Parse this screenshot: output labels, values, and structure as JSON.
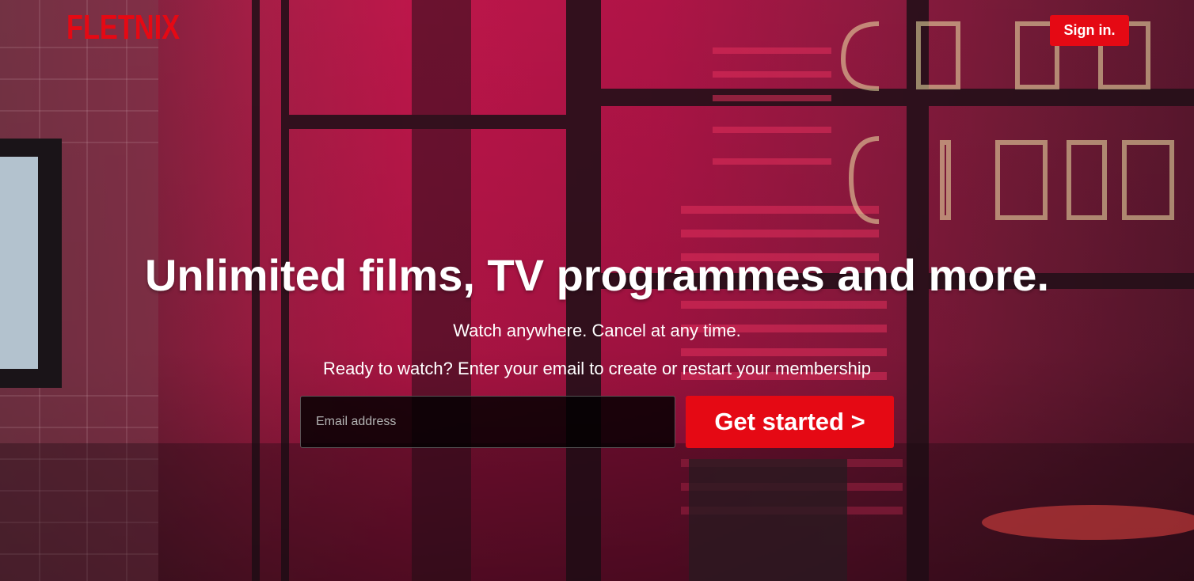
{
  "brand": {
    "logo_text": "FLETNIX",
    "accent_color": "#e50914"
  },
  "header": {
    "signin_label": "Sign in."
  },
  "hero": {
    "headline": "Unlimited films, TV programmes and more.",
    "subtitle": "Watch anywhere. Cancel at any time.",
    "prompt": "Ready to watch? Enter your email to create or restart your membership",
    "email_placeholder": "Email address",
    "email_value": "",
    "cta_label": "Get started >"
  }
}
